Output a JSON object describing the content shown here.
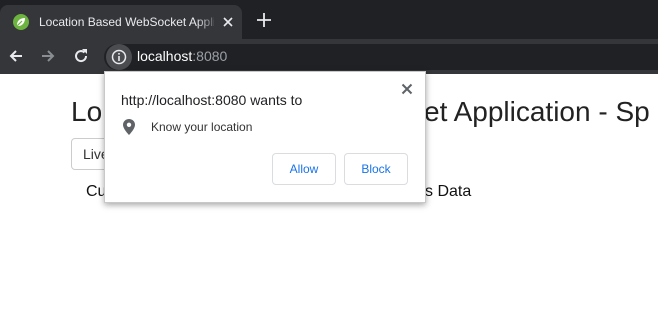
{
  "tab": {
    "title": "Location Based WebSocket Application",
    "favicon": "spring-leaf-icon"
  },
  "toolbar": {
    "url_host": "localhost",
    "url_port": ":8080"
  },
  "page": {
    "title_left": "Lo",
    "title_right": "et Application - Sp",
    "live_button": "Live",
    "col_left": "Cu",
    "col_right": "s Data"
  },
  "permission_prompt": {
    "origin_text": "http://localhost:8080 wants to",
    "permission": "Know your location",
    "allow_label": "Allow",
    "block_label": "Block"
  },
  "colors": {
    "tabstrip": "#202124",
    "toolbar": "#35363a",
    "accent": "#1a73e8",
    "spring_green": "#6db33f"
  }
}
